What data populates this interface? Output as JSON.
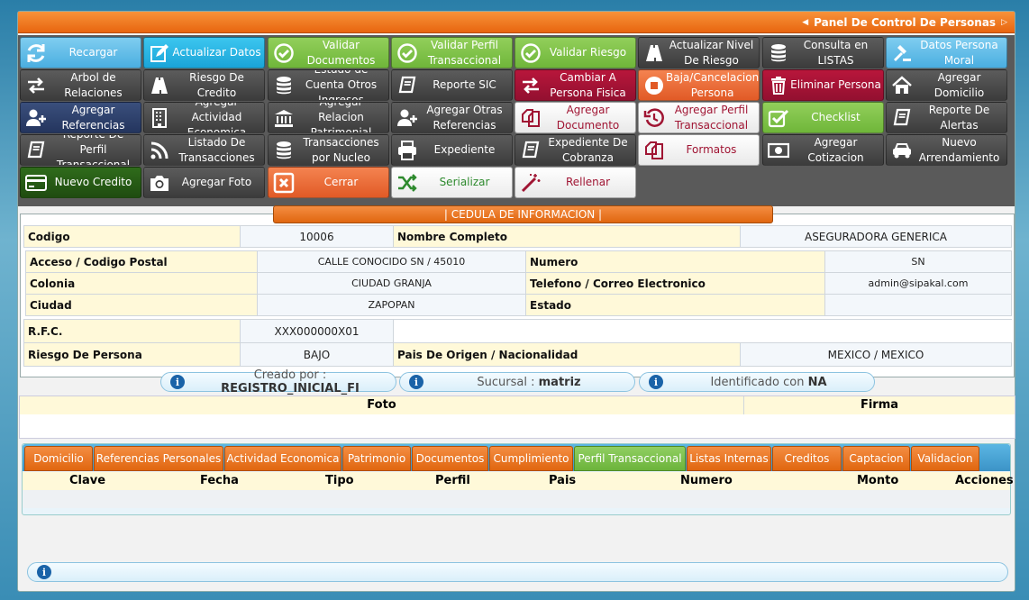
{
  "window": {
    "title": "Panel De Control De Personas"
  },
  "toolbar": {
    "buttons": [
      {
        "label": "Recargar",
        "icon": "refresh-icon",
        "color": "blue"
      },
      {
        "label": "Actualizar Datos",
        "icon": "edit-icon",
        "color": "cyan"
      },
      {
        "label": "Validar Documentos",
        "icon": "check-circle-icon",
        "color": "green"
      },
      {
        "label": "Validar Perfil Transaccional",
        "icon": "check-circle-icon",
        "color": "green"
      },
      {
        "label": "Validar Riesgo",
        "icon": "check-circle-icon",
        "color": "green"
      },
      {
        "label": "Actualizar Nivel De Riesgo",
        "icon": "road-icon",
        "color": "dark"
      },
      {
        "label": "Consulta en LISTAS",
        "icon": "database-icon",
        "color": "dark"
      },
      {
        "label": "Datos Persona Moral",
        "icon": "gavel-icon",
        "color": "blue"
      },
      {
        "label": "Arbol de Relaciones",
        "icon": "exchange-icon",
        "color": "dark"
      },
      {
        "label": "Riesgo De Credito",
        "icon": "road-icon",
        "color": "dark"
      },
      {
        "label": "Estado de Cuenta Otros Ingresos",
        "icon": "database-icon",
        "color": "dark"
      },
      {
        "label": "Reporte SIC",
        "icon": "book-icon",
        "color": "dark"
      },
      {
        "label": "Cambiar A Persona Fisica",
        "icon": "exchange-icon",
        "color": "crimson"
      },
      {
        "label": "Baja/Cancelacion Persona",
        "icon": "stop-circle-icon",
        "color": "orange"
      },
      {
        "label": "Eliminar Persona",
        "icon": "trash-icon",
        "color": "crimson"
      },
      {
        "label": "Agregar Domicilio",
        "icon": "home-icon",
        "color": "dark"
      },
      {
        "label": "Agregar Referencias",
        "icon": "add-user-icon",
        "color": "navy"
      },
      {
        "label": "Agregar Actividad Economica",
        "icon": "building-icon",
        "color": "dark"
      },
      {
        "label": "Agregar Relacion Patrimonial",
        "icon": "bank-icon",
        "color": "dark"
      },
      {
        "label": "Agregar Otras Referencias",
        "icon": "add-user-icon",
        "color": "dark"
      },
      {
        "label": "Agregar Documento",
        "icon": "copy-icon",
        "color": "white"
      },
      {
        "label": "Agregar Perfil Transaccional",
        "icon": "history-icon",
        "color": "white"
      },
      {
        "label": "Checklist",
        "icon": "checkbox-icon",
        "color": "green"
      },
      {
        "label": "Reporte De Alertas",
        "icon": "book-icon",
        "color": "dark"
      },
      {
        "label": "Reporte De Perfil Transaccional",
        "icon": "book-icon",
        "color": "dark"
      },
      {
        "label": "Listado De Transacciones",
        "icon": "rss-icon",
        "color": "dark"
      },
      {
        "label": "Transacciones por Nucleo",
        "icon": "database-icon",
        "color": "dark"
      },
      {
        "label": "Expediente",
        "icon": "print-icon",
        "color": "dark"
      },
      {
        "label": "Expediente De Cobranza",
        "icon": "book-icon",
        "color": "dark"
      },
      {
        "label": "Formatos",
        "icon": "copy-icon",
        "color": "white"
      },
      {
        "label": "Agregar Cotizacion",
        "icon": "money-icon",
        "color": "dark"
      },
      {
        "label": "Nuevo Arrendamiento",
        "icon": "car-icon",
        "color": "dark"
      },
      {
        "label": "Nuevo Credito",
        "icon": "credit-card-icon",
        "color": "dgreen"
      },
      {
        "label": "Agregar Foto",
        "icon": "camera-icon",
        "color": "dark"
      },
      {
        "label": "Cerrar",
        "icon": "close-box-icon",
        "color": "orange"
      },
      {
        "label": "Serializar",
        "icon": "shuffle-icon",
        "color": "whiteg"
      },
      {
        "label": "Rellenar",
        "icon": "magic-wand-icon",
        "color": "white"
      }
    ]
  },
  "cedula": {
    "title": "| CEDULA DE INFORMACION |",
    "codigo_label": "Codigo",
    "codigo": "10006",
    "nombre_label": "Nombre Completo",
    "nombre": "ASEGURADORA GENERICA",
    "acceso_label": "Acceso / Codigo Postal",
    "acceso": "CALLE CONOCIDO SN / 45010",
    "numero_label": "Numero",
    "numero": "SN",
    "colonia_label": "Colonia",
    "colonia": "CIUDAD GRANJA",
    "telefono_label": "Telefono / Correo Electronico",
    "telefono": "admin@sipakal.com",
    "ciudad_label": "Ciudad",
    "ciudad": "ZAPOPAN",
    "estado_label": "Estado",
    "estado": "",
    "rfc_label": "R.F.C.",
    "rfc": "XXX000000X01",
    "riesgo_label": "Riesgo De Persona",
    "riesgo": "BAJO",
    "pais_label": "Pais De Origen / Nacionalidad",
    "pais": "MEXICO / MEXICO"
  },
  "info_pills": [
    {
      "label": "Creado por :",
      "value": "REGISTRO_INICIAL_FI"
    },
    {
      "label": "Sucursal :",
      "value": "matriz"
    },
    {
      "label": "Identificado con",
      "value": "NA"
    }
  ],
  "foto_firma": {
    "foto": "Foto",
    "firma": "Firma"
  },
  "tabs": [
    {
      "label": "Domicilio",
      "active": false
    },
    {
      "label": "Referencias Personales",
      "active": false
    },
    {
      "label": "Actividad Economica",
      "active": false
    },
    {
      "label": "Patrimonio",
      "active": false
    },
    {
      "label": "Documentos",
      "active": false
    },
    {
      "label": "Cumplimiento",
      "active": false
    },
    {
      "label": "Perfil Transaccional",
      "active": true
    },
    {
      "label": "Listas Internas",
      "active": false
    },
    {
      "label": "Creditos",
      "active": false
    },
    {
      "label": "Captacion",
      "active": false
    },
    {
      "label": "Validacion",
      "active": false
    }
  ],
  "table_columns": [
    "Clave",
    "Fecha",
    "Tipo",
    "Perfil",
    "Pais",
    "Numero",
    "Monto",
    "Acciones"
  ]
}
